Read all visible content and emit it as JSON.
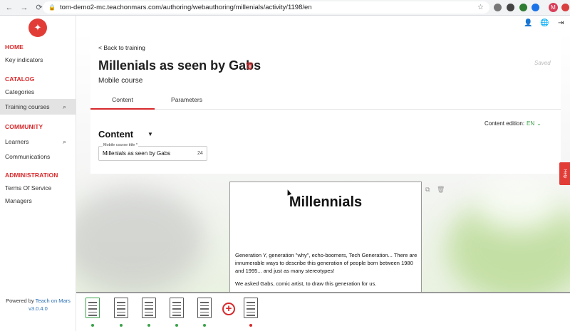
{
  "browser": {
    "url": "tom-demo2-mc.teachonmars.com/authoring/webauthoring/millenials/activity/1198/en",
    "avatar_letter": "M"
  },
  "sidebar": {
    "sections": [
      {
        "title": "HOME",
        "items": [
          {
            "label": "Key indicators"
          }
        ]
      },
      {
        "title": "CATALOG",
        "items": [
          {
            "label": "Categories"
          },
          {
            "label": "Training courses",
            "active": true,
            "search": true
          }
        ]
      },
      {
        "title": "COMMUNITY",
        "items": [
          {
            "label": "Learners",
            "search": true
          },
          {
            "label": "Communications"
          }
        ]
      },
      {
        "title": "ADMINISTRATION",
        "items": [
          {
            "label": "Terms Of Service"
          },
          {
            "label": "Managers"
          }
        ]
      }
    ],
    "powered_by": "Powered by",
    "brand": "Teach on Mars",
    "version": "v3.0.4.0"
  },
  "header": {
    "back_link": "< Back to training",
    "title": "Millenials as seen by Gabs",
    "status": "Saved",
    "subtitle": "Mobile course",
    "tabs": [
      {
        "label": "Content",
        "active": true
      },
      {
        "label": "Parameters"
      }
    ]
  },
  "content": {
    "section_title": "Content",
    "edition_label": "Content edition:",
    "edition_lang": "EN",
    "field_label": "Mobile course title *",
    "field_value": "Millenials as seen by Gabs",
    "field_count": "24"
  },
  "help_label": "Help",
  "preview": {
    "title": "Millennials",
    "paragraph1": "Generation Y, generation \"why\", echo-boomers, Tech Generation... There are innumerable ways to describe this generation of people born between 1980 and 1995... and just as many stereotypes!",
    "paragraph2": "We asked Gabs, comic artist, to draw this generation for us."
  },
  "slides": [
    {
      "active": true,
      "status_color": "#3aa24a"
    },
    {
      "active": false,
      "status_color": "#3aa24a"
    },
    {
      "active": false,
      "status_color": "#3aa24a"
    },
    {
      "active": false,
      "status_color": "#3aa24a"
    },
    {
      "active": false,
      "status_color": "#3aa24a"
    },
    {
      "active": false,
      "status_color": "#d7292b"
    }
  ],
  "colors": {
    "accent": "#d7292b",
    "ok": "#3aa24a",
    "link": "#2a6fb5"
  }
}
